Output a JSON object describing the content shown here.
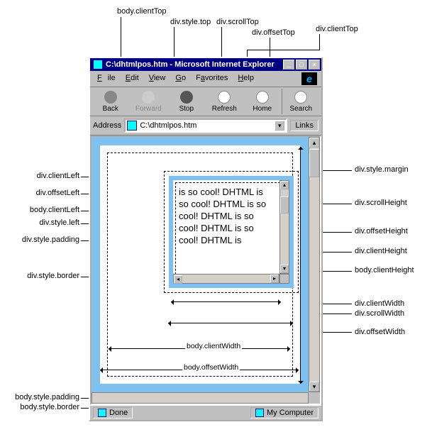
{
  "annotations": {
    "top": {
      "bodyClientTop": "body.clientTop",
      "divStyleTop": "div.style.top",
      "divScrollTop": "div.scrollTop",
      "divOffsetTop": "div.offsetTop",
      "divClientTop": "div.clientTop"
    },
    "left": {
      "divClientLeft": "div.clientLeft",
      "divOffsetLeft": "div.offsetLeft",
      "bodyClientLeft": "body.clientLeft",
      "divStyleLeft": "div.style.left",
      "divStylePadding": "div.style.padding",
      "divStyleBorder": "div.style.border"
    },
    "right": {
      "divStyleMargin": "div.style.margin",
      "divScrollHeight": "div.scrollHeight",
      "divOffsetHeight": "div.offsetHeight",
      "divClientHeight": "div.clientHeight",
      "bodyClientHeight": "body.clientHeight"
    },
    "bottom_right": {
      "divClientWidth": "div.clientWidth",
      "divScrollWidth": "div.scrollWidth",
      "divOffsetWidth": "div.offsetWidth"
    },
    "bottom_in": {
      "bodyClientWidth": "body.clientWidth",
      "bodyOffsetWidth": "body.offsetWidth"
    },
    "bottom_left": {
      "bodyStylePadding": "body.style.padding",
      "bodyStyleBorder": "body.style.border"
    }
  },
  "window": {
    "title": "C:\\dhtmlpos.htm - Microsoft Internet Explorer",
    "menu": {
      "file": "File",
      "edit": "Edit",
      "view": "View",
      "go": "Go",
      "favorites": "Favorites",
      "help": "Help"
    },
    "toolbar": {
      "back": "Back",
      "forward": "Forward",
      "stop": "Stop",
      "refresh": "Refresh",
      "home": "Home",
      "search": "Search"
    },
    "addressLabel": "Address",
    "addressValue": "C:\\dhtmlpos.htm",
    "links": "Links",
    "status": {
      "done": "Done",
      "zone": "My Computer"
    }
  },
  "content": {
    "text": "is so cool! DHTML is so cool! DHTML is so cool! DHTML is so cool! DHTML is so cool! DHTML is"
  }
}
